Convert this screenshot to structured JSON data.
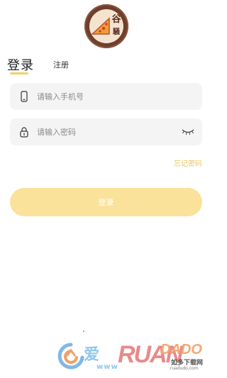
{
  "app": {
    "logo_text_top": "谷",
    "logo_text_bottom": "騒"
  },
  "tabs": {
    "login": "登录",
    "register": "注册"
  },
  "form": {
    "phone_placeholder": "请输入手机号",
    "password_placeholder": "请输入密码",
    "forgot_password": "忘记密码",
    "submit": "登录"
  },
  "colors": {
    "accent": "#f3cf67",
    "button": "#fbe29a",
    "field_bg": "#f4f4f4",
    "logo_ring": "#6e3f2a"
  },
  "icons": {
    "phone": "phone-icon",
    "lock": "lock-icon",
    "eye": "eye-closed-icon"
  },
  "watermark": {
    "ai": "爱",
    "www": "www",
    "brand": "RUAN",
    "dado": "DADO",
    "cn": "如多下载网",
    "url": ".ruadudo.com"
  }
}
